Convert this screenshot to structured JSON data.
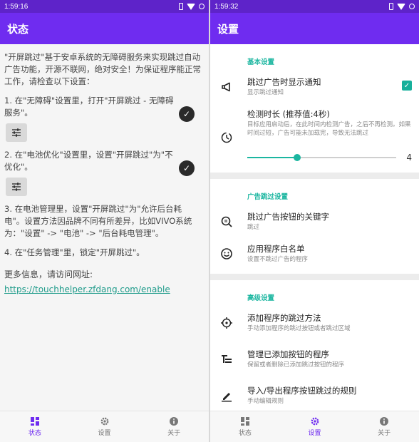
{
  "left": {
    "status_time": "1:59:16",
    "title": "状态",
    "intro": "\"开屏跳过\"基于安卓系统的无障碍服务来实现跳过自动广告功能，开源不联网，绝对安全！为保证程序能正常工作，请检查以下设置：",
    "steps": [
      {
        "text": "1. 在\"无障碍\"设置里，打开\"开屏跳过 - 无障碍服务\"。",
        "done": true
      },
      {
        "text": "2. 在\"电池优化\"设置里，设置\"开屏跳过\"为\"不优化\"。",
        "done": true
      },
      {
        "text": "3. 在电池管理里，设置\"开屏跳过\"为\"允许后台耗电\"。设置方法因品牌不同有所差异，比如VIVO系统为：\"设置\" -> \"电池\" -> \"后台耗电管理\"。"
      },
      {
        "text": "4. 在\"任务管理\"里，锁定\"开屏跳过\"。"
      }
    ],
    "more_info": "更多信息，请访问网址:",
    "link": "https://touchhelper.zfdang.com/enable",
    "nav": [
      {
        "label": "状态",
        "icon": "dashboard-icon",
        "active": true
      },
      {
        "label": "设置",
        "icon": "gear-icon",
        "active": false
      },
      {
        "label": "关于",
        "icon": "info-icon",
        "active": false
      }
    ]
  },
  "right": {
    "status_time": "1:59:32",
    "title": "设置",
    "sections": [
      {
        "header": "基本设置"
      },
      {
        "header": "广告跳过设置"
      },
      {
        "header": "高级设置"
      }
    ],
    "basic": {
      "notify_title": "跳过广告时显示通知",
      "notify_sub": "显示跳过通知",
      "notify_checked": true,
      "duration_title": "检测时长 (推荐值:4秒)",
      "duration_sub": "目标应用启动后，在此时间内检测广告，之后不再检测。如果时间过短，广告可能未加载完，导致无法跳过",
      "duration_value": "4",
      "duration_min": 1,
      "duration_max": 10,
      "duration_num": 4
    },
    "ad": {
      "keyword_title": "跳过广告按钮的关键字",
      "keyword_sub": "跳过",
      "whitelist_title": "应用程序白名单",
      "whitelist_sub": "设置不跳过广告的程序"
    },
    "advanced": {
      "add_title": "添加程序的跳过方法",
      "add_sub": "手动添加程序的跳过按钮或者跳过区域",
      "manage_title": "管理已添加按钮的程序",
      "manage_sub": "保留或者删除已添加跳过按钮的程序",
      "import_title": "导入/导出程序按钮跳过的规则",
      "import_sub": "手动编辑规则"
    },
    "nav": [
      {
        "label": "状态",
        "icon": "dashboard-icon",
        "active": false
      },
      {
        "label": "设置",
        "icon": "gear-icon",
        "active": true
      },
      {
        "label": "关于",
        "icon": "info-icon",
        "active": false
      }
    ]
  },
  "colors": {
    "status_bar": "#5e23c9",
    "app_bar": "#6f2cf0",
    "accent": "#1bb6a0",
    "link": "#1e9b8a"
  }
}
